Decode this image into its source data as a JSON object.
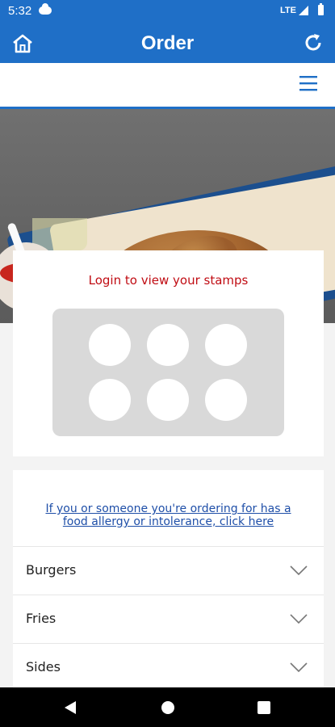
{
  "status_bar": {
    "time": "5:32",
    "network": "LTE"
  },
  "app_bar": {
    "title": "Order"
  },
  "stamps": {
    "login_text": "Login to view your stamps",
    "stamp_count": 6
  },
  "menu": {
    "allergy_line1": "If you or someone you're ordering for has a",
    "allergy_line2": "food allergy or intolerance, click here",
    "categories": [
      {
        "label": "Burgers"
      },
      {
        "label": "Fries"
      },
      {
        "label": "Sides"
      }
    ]
  },
  "colors": {
    "primary_blue": "#1f6fc7",
    "login_red": "#c00c13",
    "link_blue": "#1f4fa8"
  },
  "icons": {
    "home": "home-icon",
    "refresh": "refresh-icon",
    "menu": "hamburger-menu-icon",
    "category_chevron": "chevron-down-icon"
  }
}
